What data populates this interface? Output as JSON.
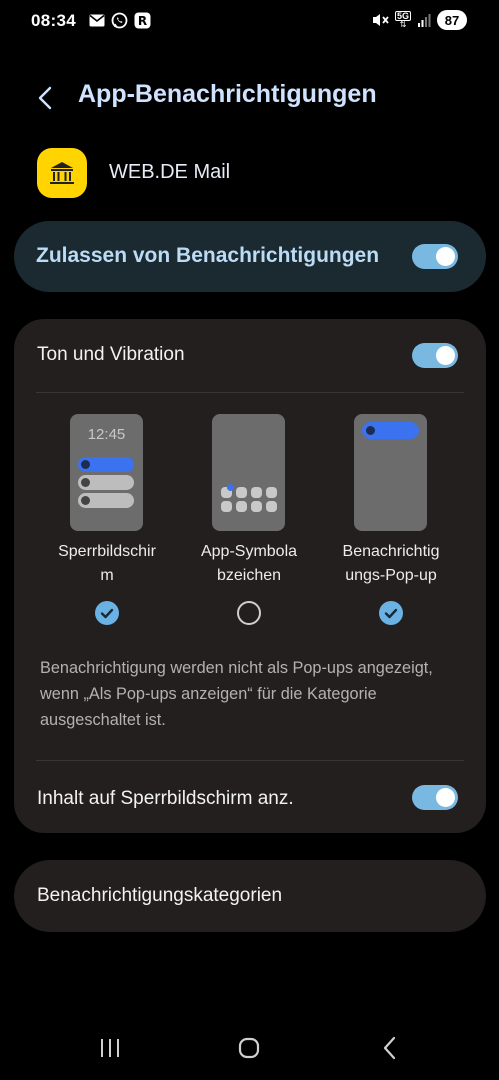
{
  "status": {
    "time": "08:34",
    "network": "5G",
    "battery": "87"
  },
  "header": {
    "title": "App-Benachrichtigungen"
  },
  "app": {
    "name": "WEB.DE Mail"
  },
  "allow": {
    "label": "Zulassen von Benachrichtigungen",
    "enabled": true
  },
  "sound": {
    "label": "Ton und Vibration",
    "enabled": true
  },
  "styles": [
    {
      "label": "Sperrbildschirm",
      "label_line1": "Sperrbildschir",
      "label_line2": "m",
      "preview_time": "12:45",
      "checked": true
    },
    {
      "label": "App-Symbolabzeichen",
      "label_line1": "App-Symbola",
      "label_line2": "bzeichen",
      "checked": false
    },
    {
      "label": "Benachrichtigungs-Pop-up",
      "label_line1": "Benachrichtig",
      "label_line2": "ungs-Pop-up",
      "checked": true
    }
  ],
  "info": {
    "text": "Benachrichtigung werden nicht als Pop-ups angezeigt, wenn „Als Pop-ups anzeigen“ für die Kategorie ausgeschaltet ist."
  },
  "lockscreen_content": {
    "label": "Inhalt auf Sperrbildschirm anz.",
    "enabled": true
  },
  "categories": {
    "label": "Benachrichtigungskategorien"
  },
  "colors": {
    "accent": "#6ab2e3",
    "toggle_on": "#79b8e0",
    "title": "#cfe3ff",
    "card": "#221f1e",
    "allow_card": "#1b2a31",
    "app_icon": "#ffd400"
  }
}
